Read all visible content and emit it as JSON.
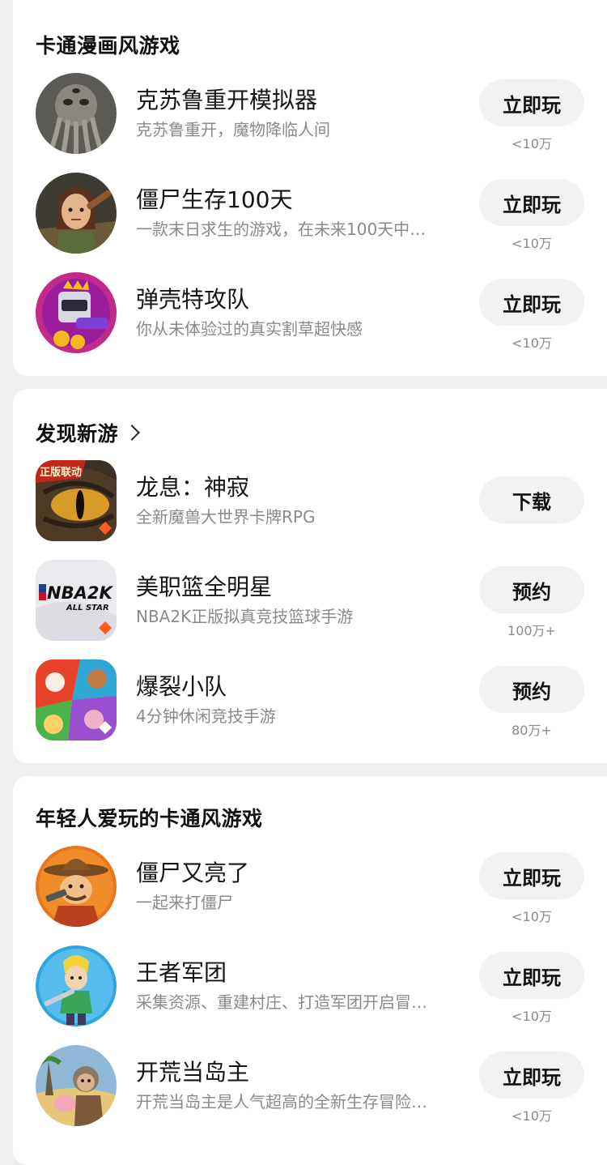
{
  "sections": [
    {
      "title": "卡通漫画风游戏",
      "games": [
        {
          "name": "克苏鲁重开模拟器",
          "desc": "克苏鲁重开，魔物降临人间",
          "button": "立即玩",
          "count": "<10万",
          "icon": "cthulhu-game-icon"
        },
        {
          "name": "僵尸生存100天",
          "desc": "一款末日求生的游戏，在未来100天中…",
          "button": "立即玩",
          "count": "<10万",
          "icon": "zombie-survival-game-icon"
        },
        {
          "name": "弹壳特攻队",
          "desc": "你从未体验过的真实割草超快感",
          "button": "立即玩",
          "count": "<10万",
          "icon": "shell-squad-game-icon"
        }
      ]
    },
    {
      "title": "发现新游",
      "games": [
        {
          "name": "龙息：神寂",
          "desc": "全新魔兽大世界卡牌RPG",
          "button": "下载",
          "count": "",
          "icon": "dragon-eye-game-icon",
          "badge": "正版联动"
        },
        {
          "name": "美职篮全明星",
          "desc": "NBA2K正版拟真竞技篮球手游",
          "button": "预约",
          "count": "100万+",
          "icon": "nba2k-game-icon",
          "logo": "NBA2K",
          "logo_sub": "ALL STAR"
        },
        {
          "name": "爆裂小队",
          "desc": "4分钟休闲竞技手游",
          "button": "预约",
          "count": "80万+",
          "icon": "burst-squad-game-icon"
        }
      ]
    },
    {
      "title": "年轻人爱玩的卡通风游戏",
      "games": [
        {
          "name": "僵尸又亮了",
          "desc": "一起来打僵尸",
          "button": "立即玩",
          "count": "<10万",
          "icon": "cowboy-zombie-game-icon"
        },
        {
          "name": "王者军团",
          "desc": "采集资源、重建村庄、打造军团开启冒…",
          "button": "立即玩",
          "count": "<10万",
          "icon": "knight-legion-game-icon"
        },
        {
          "name": "开荒当岛主",
          "desc": "开荒当岛主是人气超高的全新生存冒险…",
          "button": "立即玩",
          "count": "<10万",
          "icon": "island-owner-game-icon"
        }
      ]
    }
  ]
}
